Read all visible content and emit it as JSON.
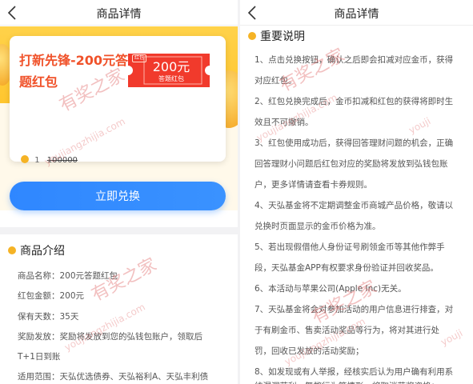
{
  "left": {
    "nav_title": "商品详情",
    "card": {
      "title": "打新先锋-200元答题红包",
      "ticket_tag": "红包",
      "ticket_amount": "200元",
      "ticket_subtitle": "答题红包",
      "price": "1",
      "original_price": "100000"
    },
    "redeem_button": "立即兑换",
    "intro": {
      "heading": "商品介绍",
      "rows": [
        "商品名称：200元答题红包",
        "红包金额：200元",
        "保有天数：35天",
        "奖励发放：奖励将发放到您的弘钱包账户，领取后",
        "T+1日到账",
        "适用范围：天弘优选债券、天弘裕利A、天弘丰利债"
      ]
    }
  },
  "right": {
    "nav_title": "商品详情",
    "notes": {
      "heading": "重要说明",
      "lines": [
        "1、点击兑换按钮，确认之后即会扣减对应金币，获得",
        "对应红包。",
        "2、红包兑换完成后，金币扣减和红包的获得将即时生",
        "效且不可撤销。",
        "3、红包使用成功后，获得回答理财问题的机会，正确",
        "回答理财小问题后红包对应的奖励将发放到弘钱包账",
        "户，更多详情请查看卡券规则。",
        "4、天弘基金将不定期调整金币商城产品价格，敬请以",
        "兑换时页面显示的金币价格为准。",
        "5、若出现假借他人身份证号刷领金币等其他作弊手",
        "段，天弘基金APP有权要求身份验证并回收奖品。",
        "6、本活动与苹果公司(Apple Inc)无关。",
        "7、天弘基金将会对参加活动的用户信息进行排查，对",
        "于有刷金币、售卖活动奖品等行为，将对其进行处",
        "罚，回收已发放的活动奖励；",
        "8、如发现或有人举报，经核实后认为用户确有利用系",
        "统漏洞获利、舞弊行为等情形，将取消获奖资格；"
      ]
    }
  },
  "watermark": {
    "cn": "有奖之家",
    "url": "youjiangzhijia.com",
    "url_short": "youji"
  },
  "colors": {
    "accent_blue": "#2f87ff",
    "title_orange": "#f0522a",
    "ticket_red": "#f13a2c",
    "coin_gold": "#f5b325"
  }
}
